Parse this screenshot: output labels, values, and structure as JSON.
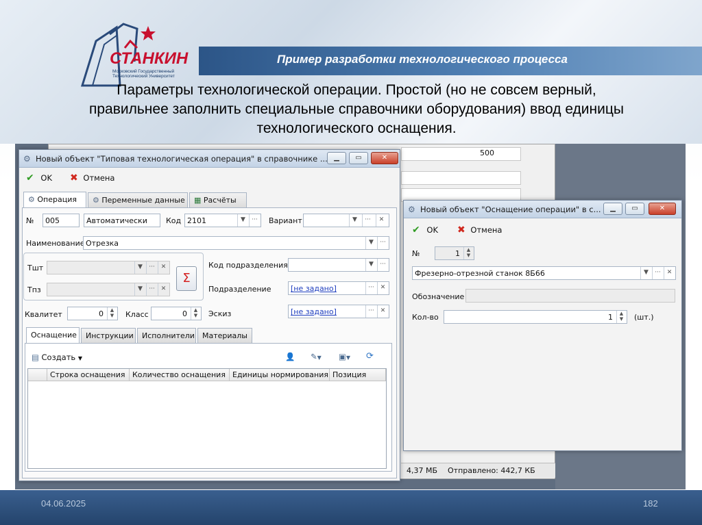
{
  "slide": {
    "title": "Пример разработки технологического процесса",
    "body": "Параметры технологической операции. Простой (но не совсем верный, правильнее заполнить специальные справочники оборудования) ввод единицы технологического оснащения.",
    "logo_text": "СТАНКИН",
    "logo_sub": "Московский Государственный Технологический Университет",
    "date": "04.06.2025",
    "page": "182"
  },
  "background_app": {
    "value_500": "500",
    "status_size": "4,37 МБ",
    "status_sent": "Отправлено: 442,7 КБ"
  },
  "main_window": {
    "title": "Новый объект \"Типовая технологическая операция\" в справочнике ...",
    "ok": "OK",
    "cancel": "Отмена",
    "tabs": [
      "Операция",
      "Переменные данные",
      "Расчёты"
    ],
    "fields": {
      "num_label": "№",
      "num_value": "005",
      "mode_value": "Автоматически",
      "code_label": "Код",
      "code_value": "2101",
      "variant_label": "Вариант",
      "name_label": "Наименование",
      "name_value": "Отрезка",
      "tsht_label": "Тшт",
      "tpz_label": "Тпз",
      "sigma": "Σ",
      "dept_code_label": "Код подразделения",
      "dept_label": "Подразделение",
      "dept_value": "[не задано]",
      "sketch_label": "Эскиз",
      "sketch_value": "[не задано]",
      "kvalitet_label": "Квалитет",
      "kvalitet_value": "0",
      "class_label": "Класс",
      "class_value": "0"
    },
    "sub_tabs": [
      "Оснащение",
      "Инструкции",
      "Исполнители",
      "Материалы"
    ],
    "create_label": "Создать",
    "grid_columns": [
      "Строка оснащения",
      "Количество оснащения",
      "Единицы нормирования",
      "Позиция"
    ]
  },
  "dialog": {
    "title": "Новый объект \"Оснащение операции\" в с...",
    "ok": "OK",
    "cancel": "Отмена",
    "num_label": "№",
    "num_value": "1",
    "equipment_value": "Фрезерно-отрезной станок 8Б66",
    "designation_label": "Обозначение",
    "qty_label": "Кол-во",
    "qty_value": "1",
    "qty_unit": "(шт.)"
  }
}
